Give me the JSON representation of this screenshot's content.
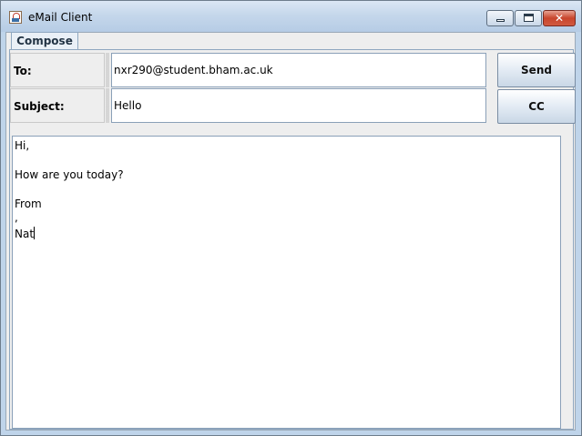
{
  "window": {
    "title": "eMail Client",
    "controls": {
      "minimize": "minimize",
      "maximize": "maximize",
      "close": "close"
    }
  },
  "tabs": [
    {
      "label": "Compose",
      "selected": true
    }
  ],
  "compose": {
    "to_label": "To:",
    "to_value": "nxr290@student.bham.ac.uk",
    "subject_label": "Subject:",
    "subject_value": "Hello",
    "send_label": "Send",
    "cc_label": "CC",
    "body_lines": [
      "Hi,",
      "",
      "How are you today?",
      "",
      "From",
      ",",
      "Nat"
    ]
  },
  "icons": {
    "app": "java-cup-icon",
    "close_glyph": "✕"
  }
}
